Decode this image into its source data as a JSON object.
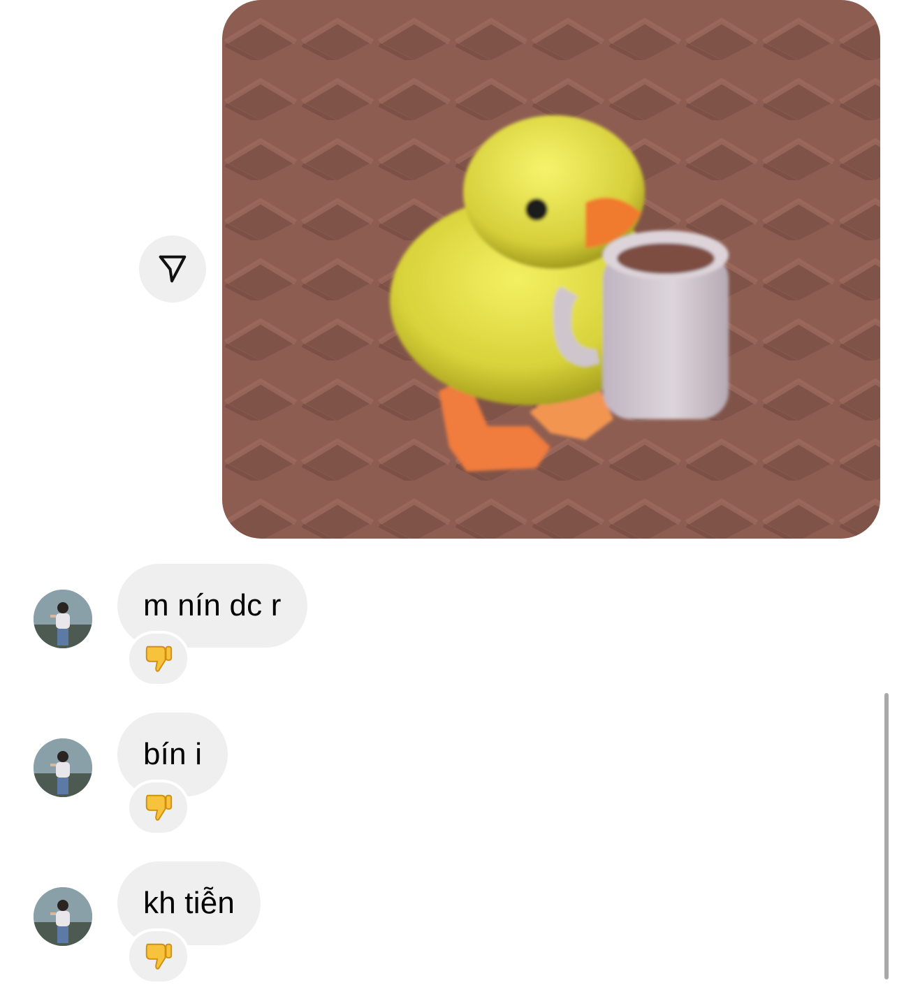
{
  "thread": {
    "sent_image": {
      "icon": "duck-with-mug-image"
    },
    "share_button": {
      "icon": "paper-plane-icon"
    },
    "messages": [
      {
        "text": "m nín dc r",
        "reaction": "thumbs-down-icon"
      },
      {
        "text": "bín i",
        "reaction": "thumbs-down-icon"
      },
      {
        "text": "kh tiễn",
        "reaction": "thumbs-down-icon"
      }
    ]
  },
  "colors": {
    "bubble_bg": "#efefef",
    "page_bg": "#ffffff",
    "text": "#000000"
  }
}
